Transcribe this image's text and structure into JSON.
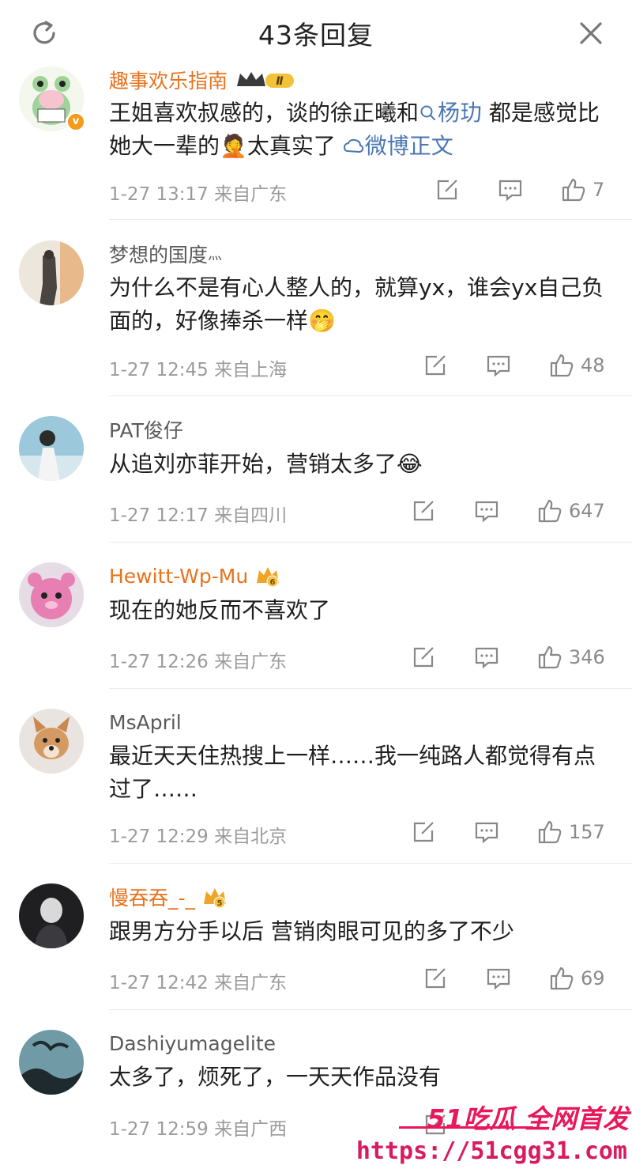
{
  "header": {
    "title": "43条回复",
    "refresh_icon": "refresh-icon",
    "close_icon": "close-icon"
  },
  "comments": [
    {
      "username": "趣事欢乐指南",
      "badge": "Ⅱ",
      "text_before_link1": "王姐喜欢叔感的，谈的徐正曦和",
      "link1": "杨玏",
      "text_mid": " 都是感觉比她大一辈的",
      "emoji": "🤦",
      "text_after_emoji": "太真实了 ",
      "link2": "微博正文",
      "time": "1-27 13:17",
      "location": "来自广东",
      "likes": "7"
    },
    {
      "username": "梦想的国度",
      "username_suffix": "灬",
      "text": "为什么不是有心人整人的，就算yx，谁会yx自己负面的，好像捧杀一样",
      "emoji": "🤭",
      "time": "1-27 12:45",
      "location": "来自上海",
      "likes": "48"
    },
    {
      "username": "PAT俊仔",
      "text": "从追刘亦菲开始，营销太多了",
      "emoji": "😂",
      "time": "1-27 12:17",
      "location": "来自四川",
      "likes": "647"
    },
    {
      "username": "Hewitt-Wp-Mu",
      "badge": "6",
      "text": "现在的她反而不喜欢了",
      "time": "1-27 12:26",
      "location": "来自广东",
      "likes": "346"
    },
    {
      "username": "MsApril",
      "text": "最近天天住热搜上一样……我一纯路人都觉得有点过了……",
      "time": "1-27 12:29",
      "location": "来自北京",
      "likes": "157"
    },
    {
      "username": "慢吞吞_-_",
      "badge": "5",
      "text": "跟男方分手以后 营销肉眼可见的多了不少",
      "time": "1-27 12:42",
      "location": "来自广东",
      "likes": "69"
    },
    {
      "username": "Dashiyumagelite",
      "text": "太多了，烦死了，一天天作品没有",
      "time": "1-27 12:59",
      "location": "来自广西"
    }
  ],
  "watermark": {
    "brand": "51吃瓜 全网首发",
    "url": "https://51cgg31.com"
  },
  "colors": {
    "vip_name": "#e8731d",
    "link": "#4a77b4",
    "meta": "#9b9b9b",
    "watermark": "#e8185a"
  }
}
